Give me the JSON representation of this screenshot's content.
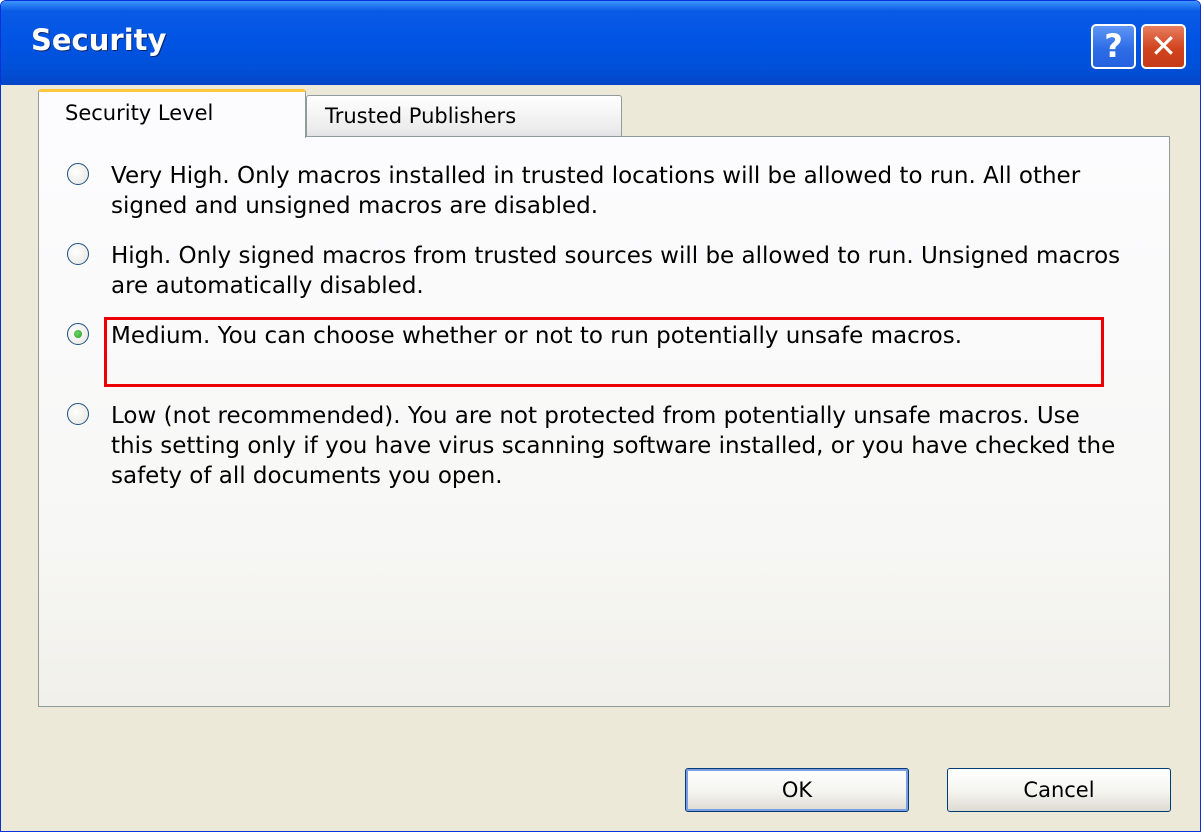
{
  "window": {
    "title": "Security",
    "help_glyph": "?",
    "close_glyph": "✕"
  },
  "tabs": [
    {
      "label": "Security Level",
      "active": true
    },
    {
      "label": "Trusted Publishers",
      "active": false
    }
  ],
  "options": [
    {
      "text": "Very High. Only macros installed in trusted locations will be allowed to run. All other signed and unsigned macros are disabled.",
      "selected": false
    },
    {
      "text": "High. Only signed macros from trusted sources will be allowed to run. Unsigned macros are automatically disabled.",
      "selected": false
    },
    {
      "text": "Medium. You can choose whether or not to run potentially unsafe macros.",
      "selected": true
    },
    {
      "text": "Low (not recommended). You are not protected from potentially unsafe macros. Use this setting only if you have virus scanning software installed, or you have checked the safety of all documents you open.",
      "selected": false
    }
  ],
  "buttons": {
    "ok": "OK",
    "cancel": "Cancel"
  },
  "colors": {
    "titlebar": "#0054e3",
    "highlight": "#ee0000",
    "radio_checked": "#21a121"
  },
  "icons": {
    "help": "help-icon",
    "close": "close-icon"
  }
}
